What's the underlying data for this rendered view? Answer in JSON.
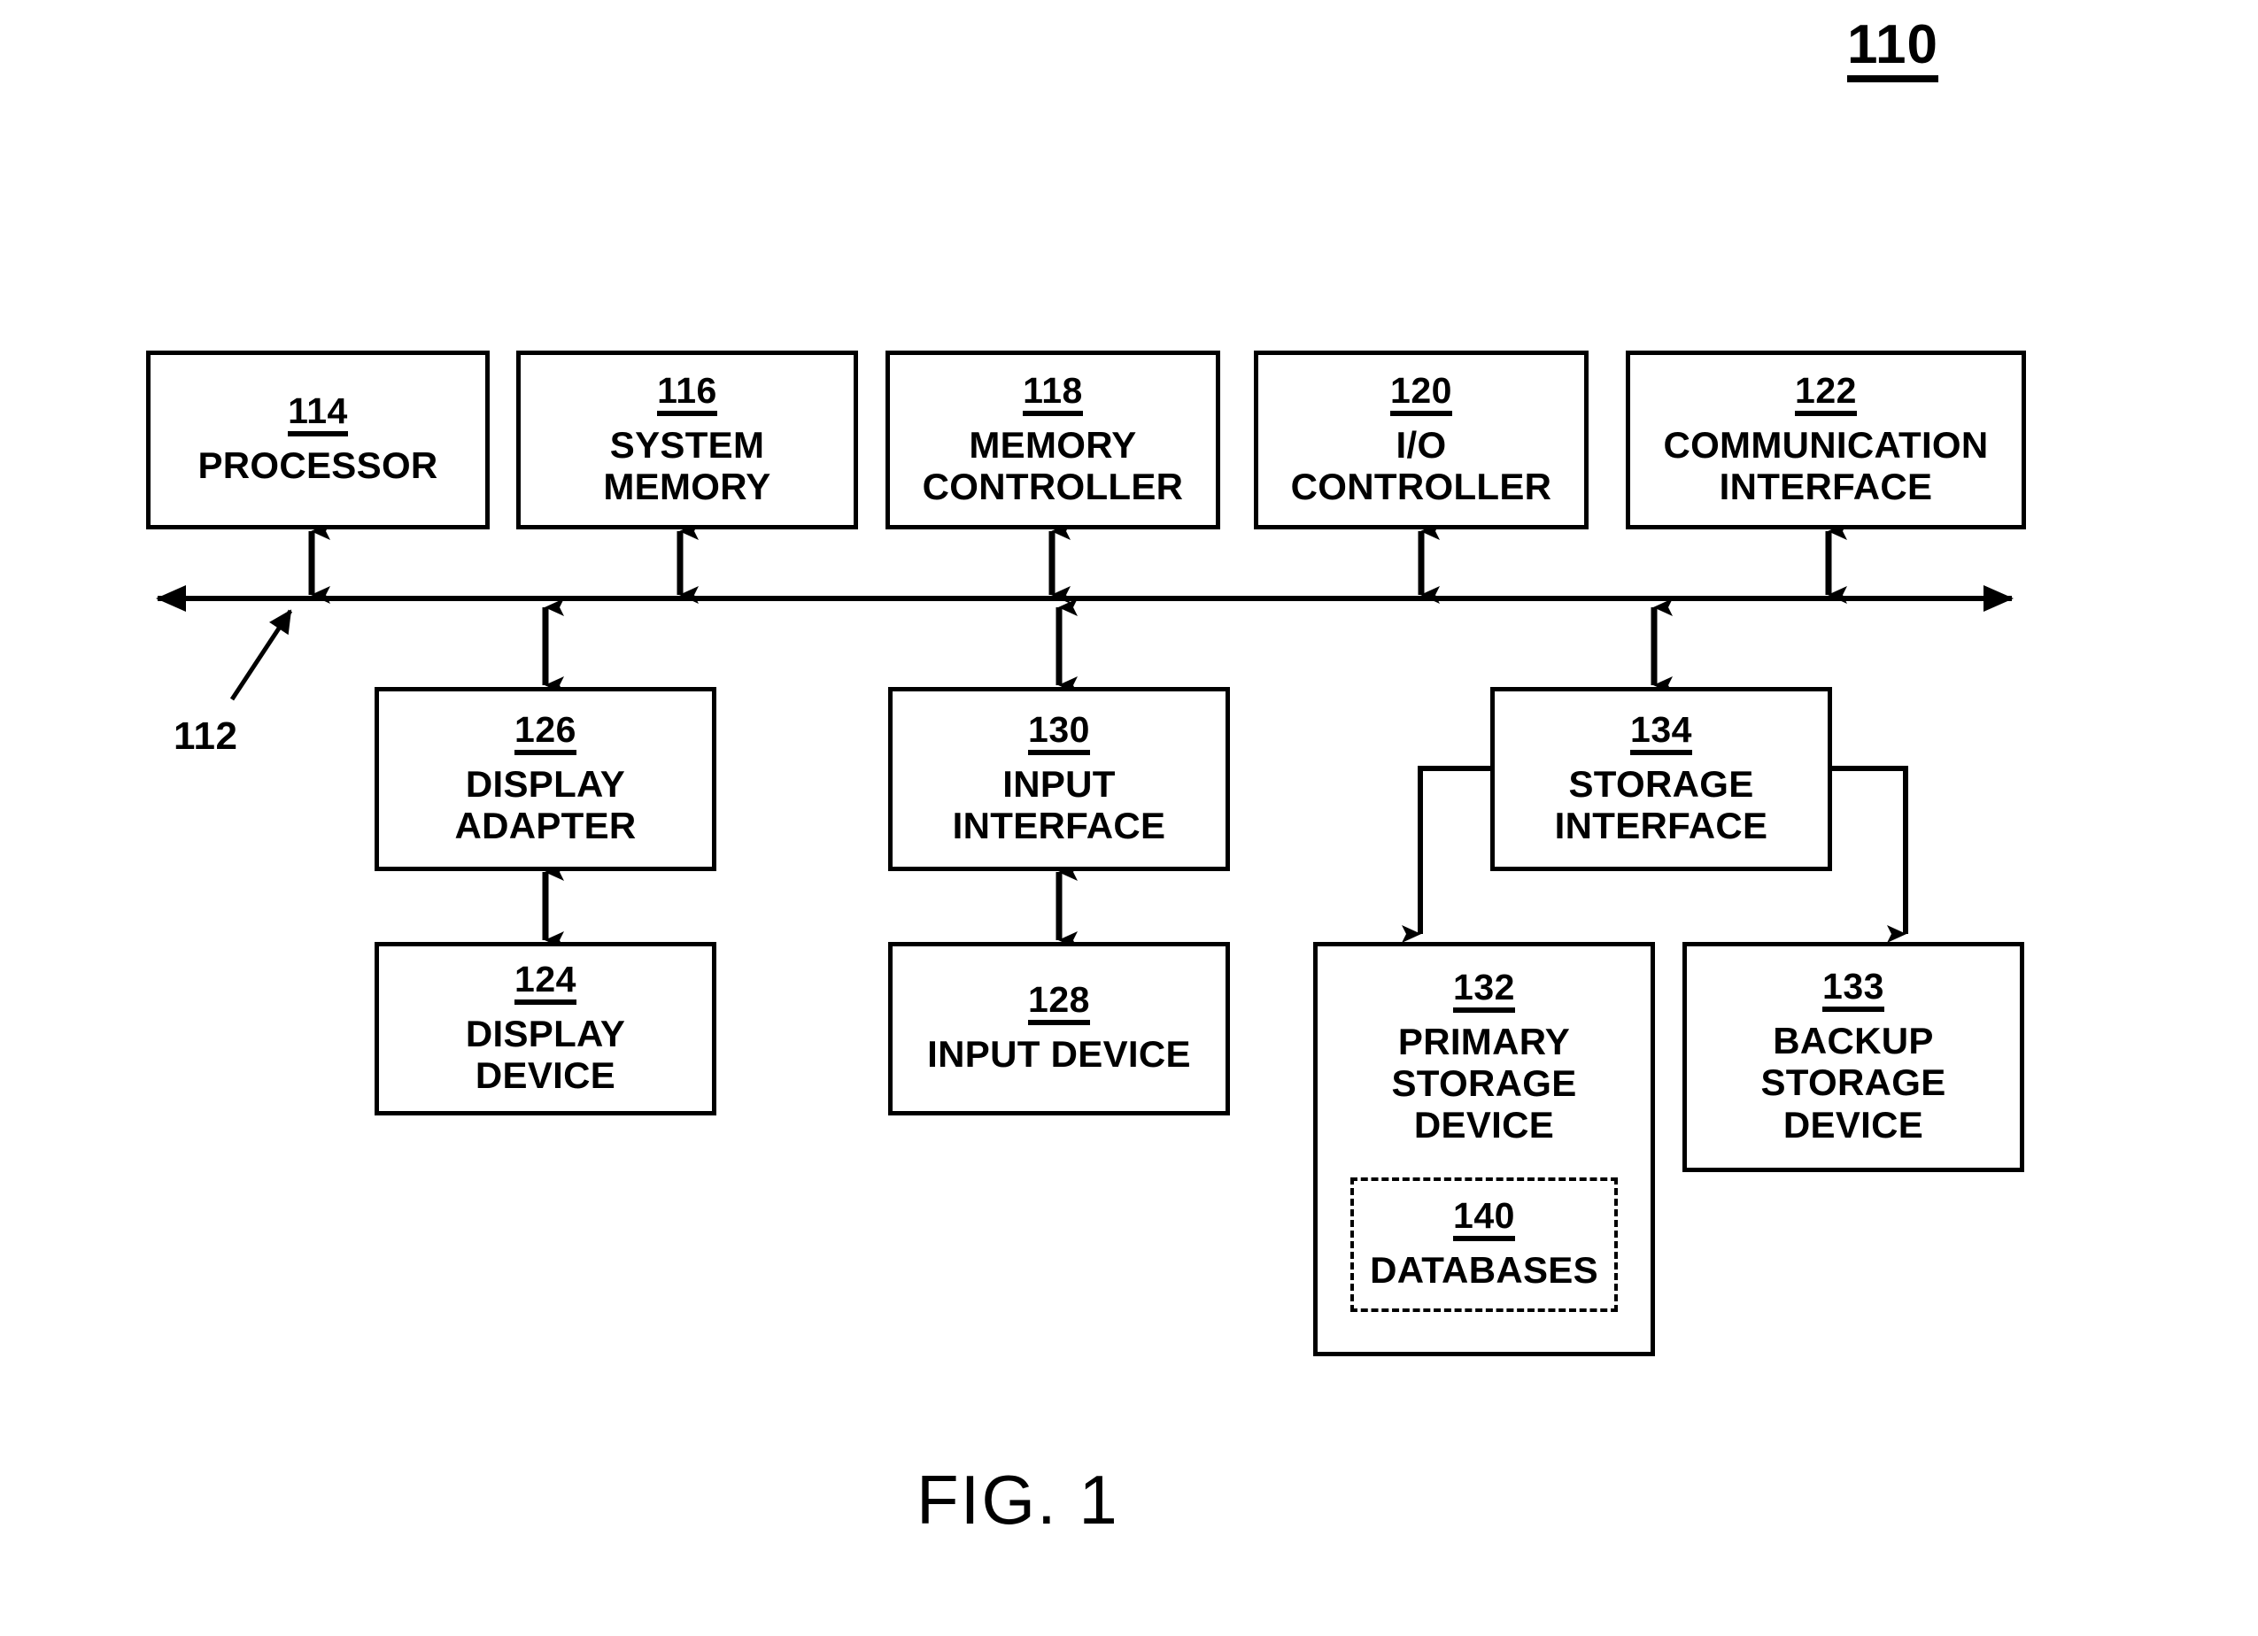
{
  "figure": {
    "number_label": "110",
    "caption": "FIG. 1",
    "bus_ref": "112"
  },
  "nodes": {
    "processor": {
      "ref": "114",
      "label": "PROCESSOR"
    },
    "system_memory": {
      "ref": "116",
      "label": "SYSTEM\nMEMORY"
    },
    "memory_controller": {
      "ref": "118",
      "label": "MEMORY\nCONTROLLER"
    },
    "io_controller": {
      "ref": "120",
      "label": "I/O\nCONTROLLER"
    },
    "communication_interface": {
      "ref": "122",
      "label": "COMMUNICATION\nINTERFACE"
    },
    "display_adapter": {
      "ref": "126",
      "label": "DISPLAY\nADAPTER"
    },
    "input_interface": {
      "ref": "130",
      "label": "INPUT\nINTERFACE"
    },
    "storage_interface": {
      "ref": "134",
      "label": "STORAGE\nINTERFACE"
    },
    "display_device": {
      "ref": "124",
      "label": "DISPLAY\nDEVICE"
    },
    "input_device": {
      "ref": "128",
      "label": "INPUT DEVICE"
    },
    "primary_storage_device": {
      "ref": "132",
      "label": "PRIMARY\nSTORAGE\nDEVICE"
    },
    "backup_storage_device": {
      "ref": "133",
      "label": "BACKUP\nSTORAGE\nDEVICE"
    },
    "databases": {
      "ref": "140",
      "label": "DATABASES"
    }
  },
  "style": {
    "stroke": "#000000",
    "fill": "#ffffff"
  }
}
